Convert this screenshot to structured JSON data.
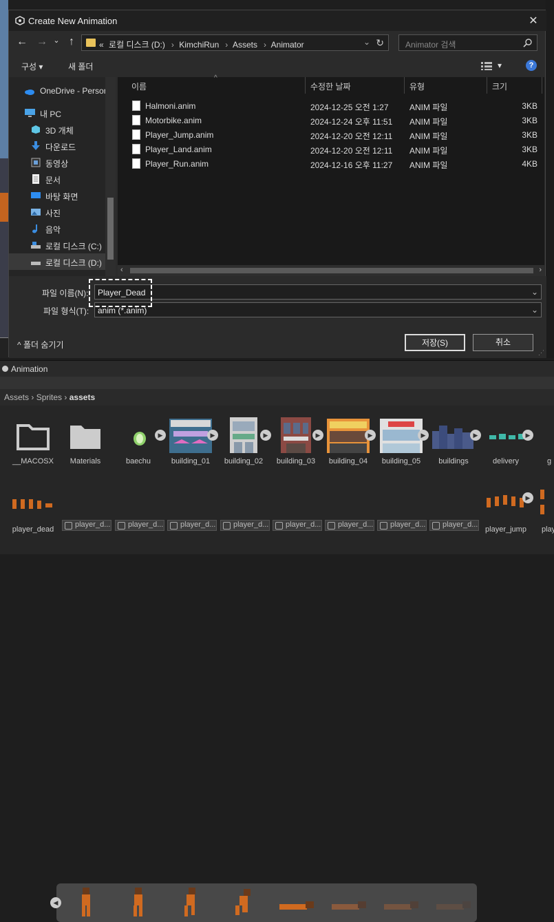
{
  "dialog": {
    "title": "Create New Animation",
    "close": "✕",
    "nav": {
      "back": "←",
      "forward": "→",
      "dropdown": "⌄",
      "up": "↑"
    },
    "address": {
      "prefix": "«",
      "crumbs": [
        "로컬 디스크 (D:)",
        "KimchiRun",
        "Assets",
        "Animator"
      ],
      "sep": "›"
    },
    "search_placeholder": "Animator 검색",
    "toolbar": {
      "organize": "구성 ▾",
      "new_folder": "새 폴더",
      "view": "▾",
      "help": "?"
    },
    "nav_pane": [
      {
        "label": "OneDrive - Person",
        "icon": "onedrive-icon"
      },
      {
        "label": "내 PC",
        "icon": "pc-icon"
      },
      {
        "label": "3D 개체",
        "icon": "3d-objects-icon"
      },
      {
        "label": "다운로드",
        "icon": "download-icon"
      },
      {
        "label": "동영상",
        "icon": "video-icon"
      },
      {
        "label": "문서",
        "icon": "document-icon"
      },
      {
        "label": "바탕 화면",
        "icon": "desktop-icon"
      },
      {
        "label": "사진",
        "icon": "pictures-icon"
      },
      {
        "label": "음악",
        "icon": "music-icon"
      },
      {
        "label": "로컬 디스크 (C:)",
        "icon": "drive-icon"
      },
      {
        "label": "로컬 디스크 (D:)",
        "icon": "drive-icon"
      }
    ],
    "columns": {
      "name": "이름",
      "date": "수정한 날짜",
      "type": "유형",
      "size": "크기"
    },
    "files": [
      {
        "name": "Halmoni.anim",
        "date": "2024-12-25 오전 1:27",
        "type": "ANIM 파일",
        "size": "3KB"
      },
      {
        "name": "Motorbike.anim",
        "date": "2024-12-24 오후 11:51",
        "type": "ANIM 파일",
        "size": "3KB"
      },
      {
        "name": "Player_Jump.anim",
        "date": "2024-12-20 오전 12:11",
        "type": "ANIM 파일",
        "size": "3KB"
      },
      {
        "name": "Player_Land.anim",
        "date": "2024-12-20 오전 12:11",
        "type": "ANIM 파일",
        "size": "3KB"
      },
      {
        "name": "Player_Run.anim",
        "date": "2024-12-16 오후 11:27",
        "type": "ANIM 파일",
        "size": "4KB"
      }
    ],
    "filename_label": "파일 이름(N):",
    "filename_value": "Player_Dead",
    "filetype_label": "파일 형식(T):",
    "filetype_value": "anim (*.anim)",
    "hide_folders": "^  폴더 숨기기",
    "save": "저장(S)",
    "cancel": "취소"
  },
  "animation_panel": {
    "title": "Animation",
    "breadcrumb": {
      "a": "Assets",
      "b": "Sprites",
      "c": "assets",
      "sep": "›"
    },
    "assets_row1": [
      "__MACOSX",
      "Materials",
      "baechu",
      "building_01",
      "building_02",
      "building_03",
      "building_04",
      "building_05",
      "buildings",
      "delivery",
      "g"
    ],
    "assets_row2_left": "player_dead",
    "assets_row2_subs": [
      "player_d...",
      "player_d...",
      "player_d...",
      "player_d...",
      "player_d...",
      "player_d...",
      "player_d...",
      "player_d..."
    ],
    "assets_row2_right": [
      "player_jump",
      "play"
    ]
  }
}
